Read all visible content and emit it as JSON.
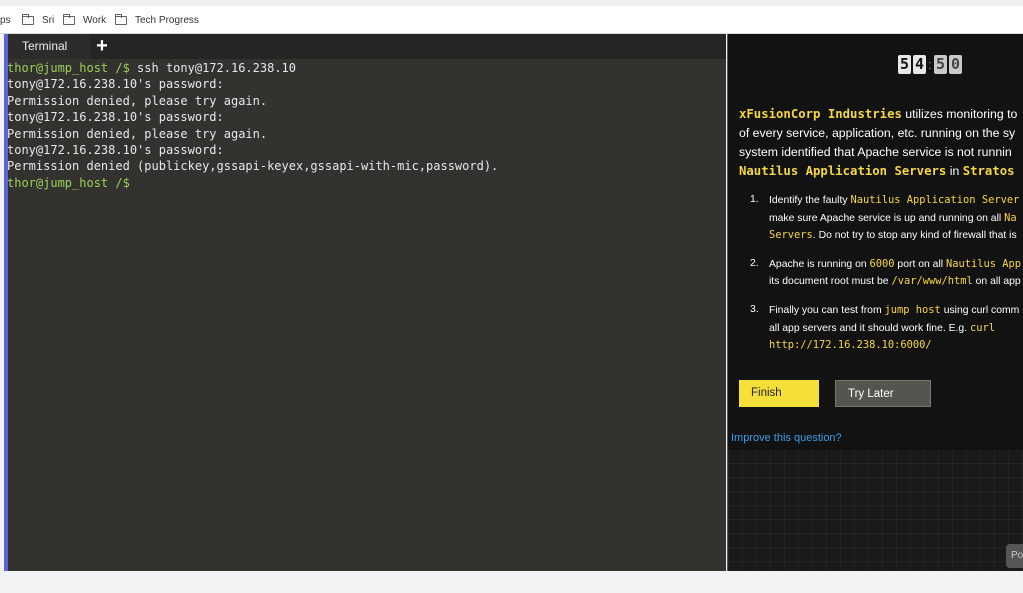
{
  "bookmarks": {
    "partial_item": "ps",
    "items": [
      "Sri",
      "Work",
      "Tech Progress"
    ]
  },
  "terminal": {
    "tab_label": "Terminal",
    "add_tab": "+",
    "lines": [
      {
        "prompt": "thor@jump_host /$",
        "text": " ssh tony@172.16.238.10"
      },
      {
        "prompt": "",
        "text": "tony@172.16.238.10's password:"
      },
      {
        "prompt": "",
        "text": "Permission denied, please try again."
      },
      {
        "prompt": "",
        "text": "tony@172.16.238.10's password:"
      },
      {
        "prompt": "",
        "text": "Permission denied, please try again."
      },
      {
        "prompt": "",
        "text": "tony@172.16.238.10's password:"
      },
      {
        "prompt": "",
        "text": "Permission denied (publickey,gssapi-keyex,gssapi-with-mic,password)."
      },
      {
        "prompt": "thor@jump_host /$",
        "text": ""
      }
    ]
  },
  "timer": {
    "digits": [
      "5",
      "4",
      "5",
      "0"
    ]
  },
  "task": {
    "company": "xFusionCorp Industries",
    "desc_1": " utilizes monitoring to",
    "desc_2": "of every service, application, etc. running on the sy",
    "desc_3": "system identified that Apache service is not runnin",
    "servers": "Nautilus Application Servers",
    "in": " in ",
    "dc": "Stratos",
    "steps": [
      {
        "num": "1.",
        "a": "Identify the faulty ",
        "code1": "Nautilus Application Server",
        "b": "make sure Apache service is up and running on all ",
        "code2": "Na",
        "c_code": "Servers",
        "c": ". Do not try to stop any kind of firewall that is"
      },
      {
        "num": "2.",
        "a": "Apache is running on ",
        "code1": "6000",
        "a2": " port on all ",
        "code2": "Nautilus App",
        "b": "its document root must be ",
        "code3": "/var/www/html",
        "b2": " on all app"
      },
      {
        "num": "3.",
        "a": "Finally you can test from ",
        "code1": "jump host",
        "a2": " using curl comm",
        "b": "all app servers and it should work fine. E.g. ",
        "code2": "curl",
        "code3": "http://172.16.238.10:6000/"
      }
    ],
    "finish_label": "Finish",
    "try_later_label": "Try Later",
    "improve_label": "Improve this question?",
    "powered_partial": "Po"
  }
}
